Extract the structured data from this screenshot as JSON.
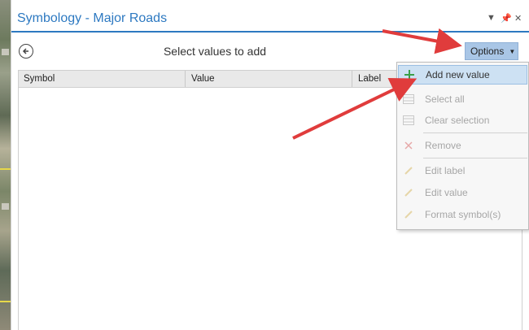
{
  "pane": {
    "title": "Symbology - Major Roads",
    "menu_icon": "dropdown-triangle",
    "pin_icon": "pin-icon",
    "close_icon": "close-icon",
    "heading": "Select values to add",
    "back_icon": "back-arrow-circle-icon",
    "options_label": "Options"
  },
  "table": {
    "columns": [
      "Symbol",
      "Value",
      "Label"
    ]
  },
  "menu": {
    "items": [
      {
        "label": "Add new value",
        "icon": "plus-icon",
        "state": "hover"
      },
      {
        "label": "Select all",
        "icon": "select-all-icon",
        "state": "disabled"
      },
      {
        "label": "Clear selection",
        "icon": "clear-selection-icon",
        "state": "disabled"
      },
      {
        "label": "Remove",
        "icon": "remove-x-icon",
        "state": "disabled"
      },
      {
        "label": "Edit label",
        "icon": "pencil-icon",
        "state": "disabled"
      },
      {
        "label": "Edit value",
        "icon": "pencil-icon",
        "state": "disabled"
      },
      {
        "label": "Format symbol(s)",
        "icon": "pencil-icon",
        "state": "disabled"
      }
    ]
  },
  "colors": {
    "accent": "#2d79c1",
    "options_bg": "#a9c6e6",
    "annotation_arrow": "#e03c3c"
  }
}
